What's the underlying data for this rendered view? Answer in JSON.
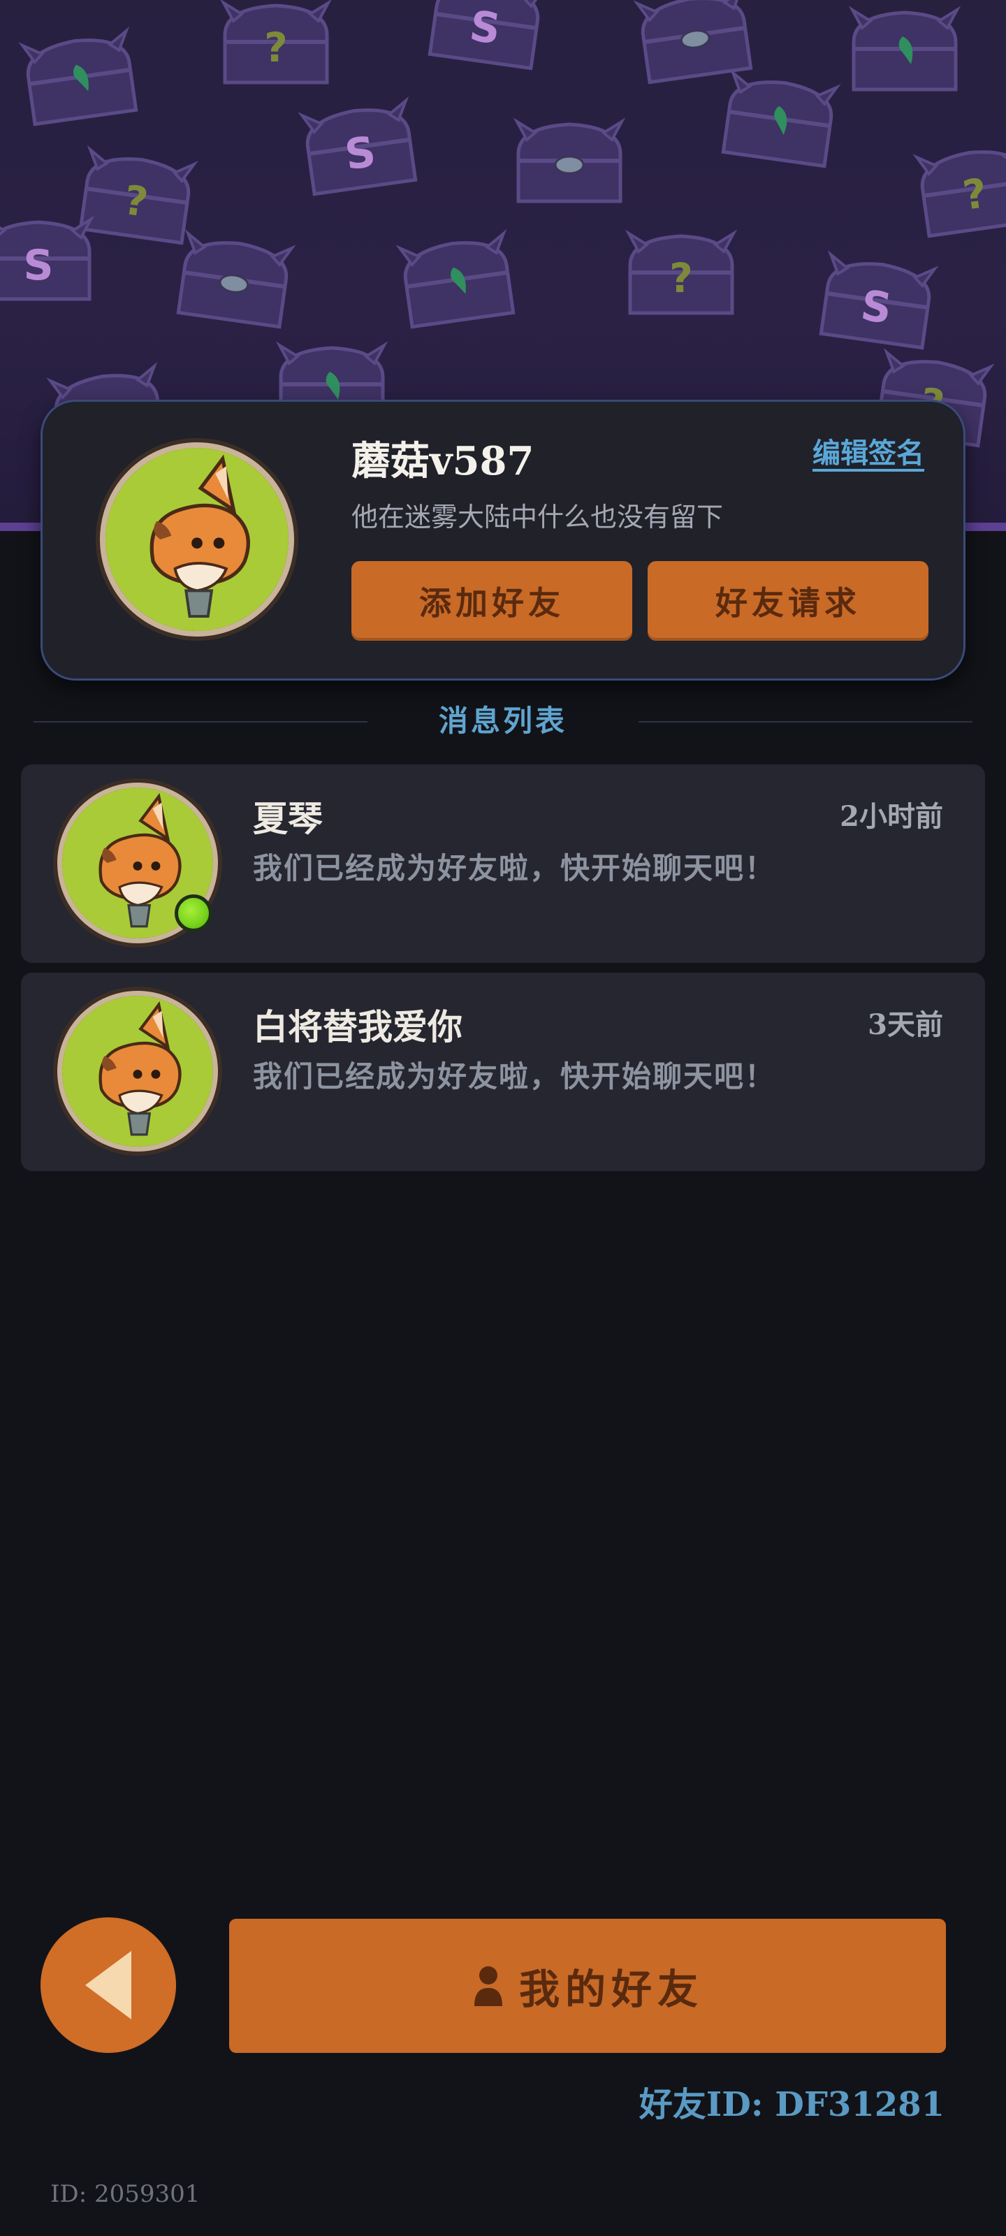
{
  "colors": {
    "background": "#121318",
    "banner": "#27203f",
    "accent_orange": "#c96a27",
    "accent_blue": "#5aa7d8",
    "online": "#76d21c"
  },
  "profile": {
    "name": "蘑菇v587",
    "edit_sign_label": "编辑签名",
    "signature": "他在迷雾大陆中什么也没有留下",
    "add_friend_label": "添加好友",
    "friend_request_label": "好友请求",
    "avatar_icon": "fox-avatar-icon"
  },
  "section": {
    "title": "消息列表"
  },
  "messages": [
    {
      "name": "夏琴",
      "time": "2小时前",
      "text": "我们已经成为好友啦，快开始聊天吧！",
      "online": true
    },
    {
      "name": "白将替我爱你",
      "time": "3天前",
      "text": "我们已经成为好友啦，快开始聊天吧！",
      "online": false
    }
  ],
  "footer": {
    "back_icon": "back-arrow-icon",
    "my_friends_label": "我的好友",
    "friend_id": "好友ID: DF31281",
    "user_id": "ID: 2059301"
  }
}
